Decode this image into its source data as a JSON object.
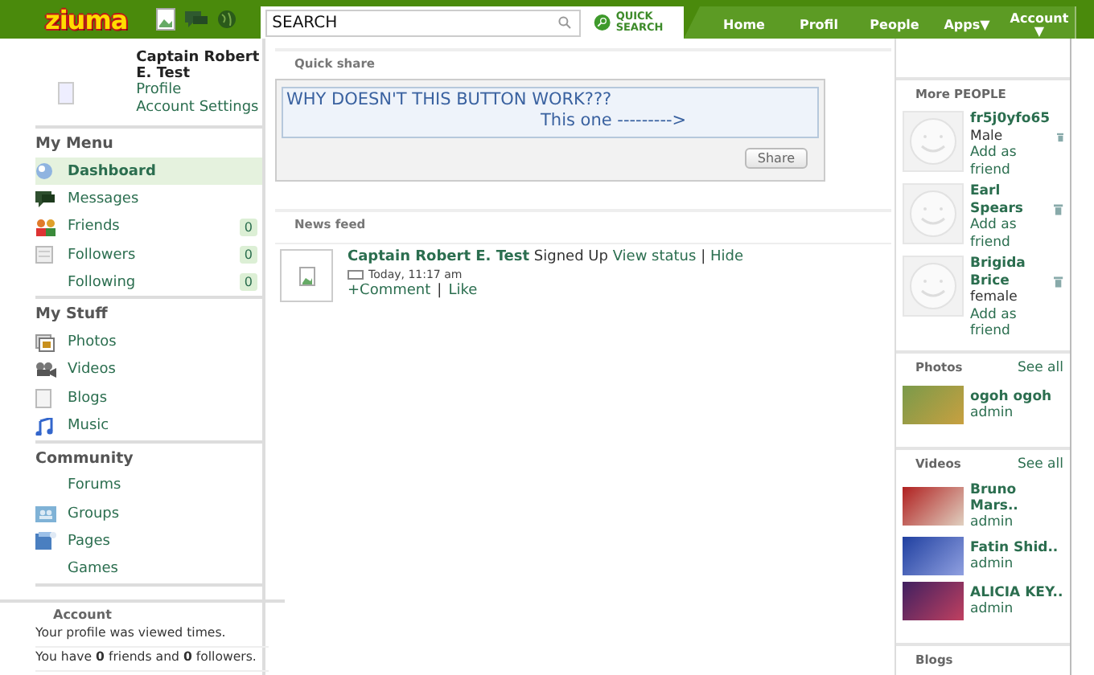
{
  "header": {
    "logo": "ziuma",
    "search": {
      "value": "SEARCH"
    },
    "quick_search": "QUICK SEARCH",
    "nav": [
      {
        "label": "Home"
      },
      {
        "label": "Profil"
      },
      {
        "label": "People"
      },
      {
        "label": "Apps",
        "caret": "▼"
      },
      {
        "label": "Account",
        "caret": "▼"
      }
    ]
  },
  "profile": {
    "name": "Captain Robert E. Test",
    "links": [
      "Profile",
      "Account Settings"
    ]
  },
  "menus": [
    {
      "title": "My Menu",
      "items": [
        {
          "label": "Dashboard",
          "selected": true
        },
        {
          "label": "Messages",
          "selected": false
        },
        {
          "label": "Friends",
          "selected": false,
          "count": "0"
        },
        {
          "label": "Followers",
          "selected": false,
          "count": "0"
        },
        {
          "label": "Following",
          "selected": false,
          "count": "0"
        }
      ]
    },
    {
      "title": "My Stuff",
      "items": [
        {
          "label": "Photos",
          "selected": false
        },
        {
          "label": "Videos",
          "selected": false
        },
        {
          "label": "Blogs",
          "selected": false
        },
        {
          "label": "Music",
          "selected": false
        }
      ]
    },
    {
      "title": "Community",
      "items": [
        {
          "label": "Forums",
          "selected": false
        },
        {
          "label": "Groups",
          "selected": false
        },
        {
          "label": "Pages",
          "selected": false
        },
        {
          "label": "Games",
          "selected": false
        }
      ]
    }
  ],
  "account": {
    "title": "Account",
    "lines": [
      "Your profile was viewed times.",
      "You have **0** friends and **0** followers."
    ]
  },
  "quick_share": {
    "title": "Quick share",
    "value_lines": [
      "WHY DOESN'T THIS BUTTON WORK???",
      "This one --------->"
    ],
    "button": "Share"
  },
  "news_feed": {
    "title": "News feed",
    "items": [
      {
        "author": "Captain Robert E. Test",
        "action": "Signed Up",
        "links": [
          "View status",
          "Hide"
        ],
        "link_separator": "|",
        "time": "Today, 11:17 am",
        "actions": [
          "+Comment",
          "Like"
        ],
        "action_separator": "|"
      }
    ]
  },
  "more_people": {
    "title": "More PEOPLE",
    "people": [
      {
        "name": "fr5j0yfo65",
        "gender": "Male",
        "action": "Add as friend"
      },
      {
        "name": "Earl Spears",
        "action": "Add as friend"
      },
      {
        "name": "Brigida Brice",
        "gender": "female",
        "action": "Add as friend"
      }
    ]
  },
  "media": [
    {
      "title": "Photos",
      "see_all": "See all",
      "items": [
        {
          "title": "ogoh ogoh",
          "author": "admin"
        }
      ]
    },
    {
      "title": "Videos",
      "see_all": "See all",
      "items": [
        {
          "title": "Bruno Mars..",
          "author": "admin"
        },
        {
          "title": "Fatin Shid..",
          "author": "admin"
        },
        {
          "title": "ALICIA KEY..",
          "author": "admin"
        }
      ]
    }
  ],
  "blogs": {
    "title": "Blogs"
  }
}
